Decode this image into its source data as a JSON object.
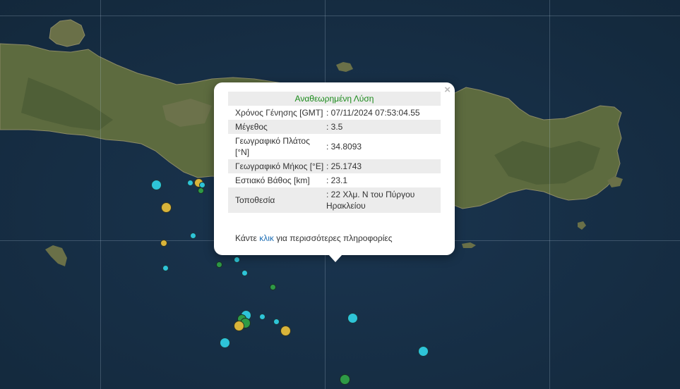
{
  "popup": {
    "header": "Αναθεωρημένη Λύση",
    "close_symbol": "×",
    "rows": [
      {
        "label": "Χρόνος Γένησης [GMT]",
        "value": ": 07/11/2024 07:53:04.55"
      },
      {
        "label": "Μέγεθος",
        "value": ": 3.5"
      },
      {
        "label": "Γεωγραφικό Πλάτος [°N]",
        "value": ": 34.8093"
      },
      {
        "label": "Γεωγραφικό Μήκος [°E]",
        "value": ": 25.1743"
      },
      {
        "label": "Εστιακό Βάθος [km]",
        "value": ": 23.1"
      },
      {
        "label": "Τοποθεσία",
        "value": ": 22 Χλμ. Ν του Πύργου Ηρακλείου"
      }
    ],
    "more_before": "Κάντε",
    "more_link": "κλικ",
    "more_after": "για περισσότερες πληροφορίες"
  },
  "colors": {
    "sea": "#172f45",
    "land": "#5b6a3e",
    "quake_cyan": "#2ec4d8",
    "quake_yellow": "#d9b43a",
    "quake_green": "#2e9a46",
    "header_green": "#1a8a1a",
    "link_blue": "#1f6fb5"
  }
}
